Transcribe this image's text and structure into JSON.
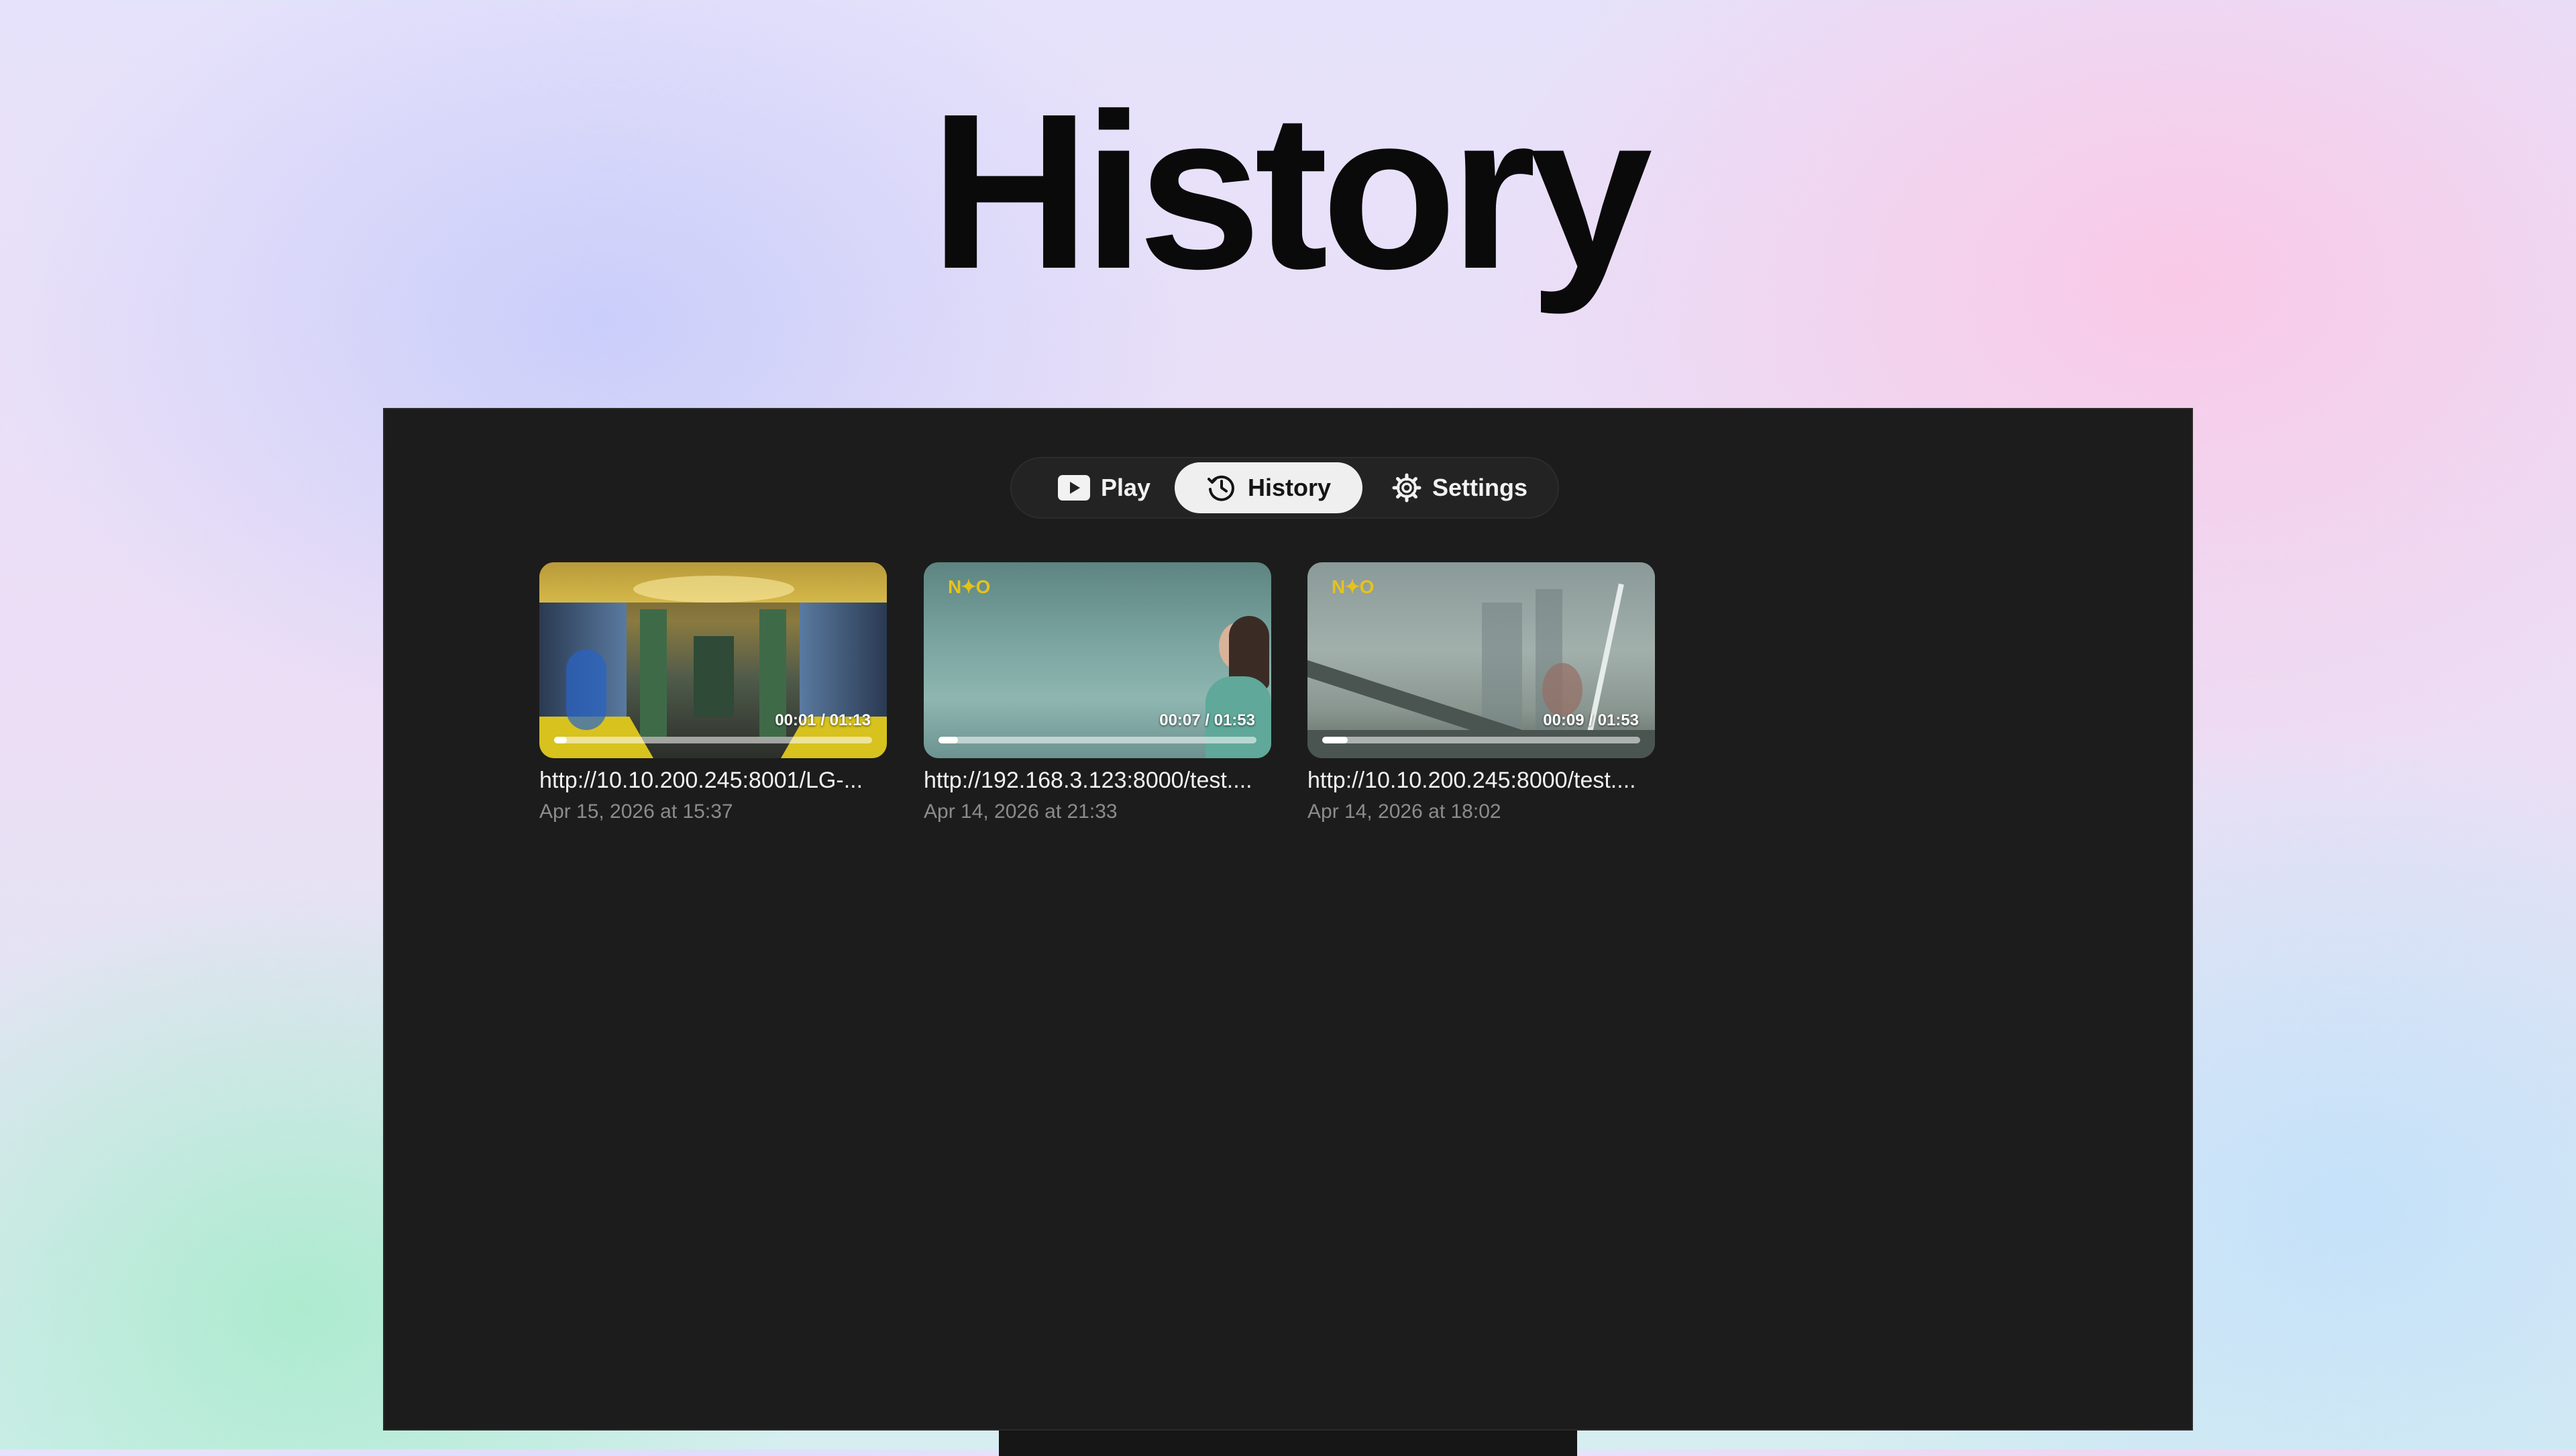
{
  "page": {
    "title": "History"
  },
  "tabs": [
    {
      "label": "Play",
      "icon": "play-icon",
      "selected": false
    },
    {
      "label": "History",
      "icon": "history-icon",
      "selected": true
    },
    {
      "label": "Settings",
      "icon": "gear-icon",
      "selected": false
    }
  ],
  "history": [
    {
      "url": "http://10.10.200.245:8001/LG-...",
      "date": "Apr 15, 2026 at 15:37",
      "time": "00:01 / 01:13",
      "progress": 0.014
    },
    {
      "url": "http://192.168.3.123:8000/test....",
      "date": "Apr 14, 2026 at 21:33",
      "time": "00:07 / 01:53",
      "progress": 0.062
    },
    {
      "url": "http://10.10.200.245:8000/test....",
      "date": "Apr 14, 2026 at 18:02",
      "time": "00:09 / 01:53",
      "progress": 0.08
    }
  ],
  "colors": {
    "screen": "#1c1c1c",
    "selected_tab": "#efefef",
    "logo": "#e8c21a"
  }
}
